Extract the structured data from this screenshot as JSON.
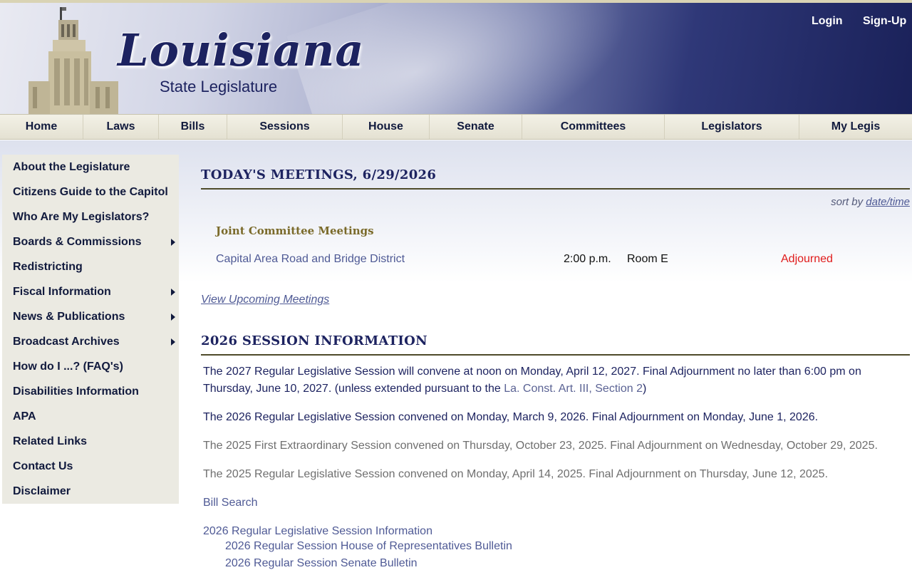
{
  "header": {
    "logo_title": "Louisiana",
    "logo_subtitle": "State Legislature",
    "login_label": "Login",
    "signup_label": "Sign-Up"
  },
  "nav": {
    "items": [
      "Home",
      "Laws",
      "Bills",
      "Sessions",
      "House",
      "Senate",
      "Committees",
      "Legislators",
      "My Legis"
    ]
  },
  "sidebar": {
    "items": [
      {
        "label": "About the Legislature",
        "has_submenu": false
      },
      {
        "label": "Citizens Guide to the Capitol",
        "has_submenu": false
      },
      {
        "label": "Who Are My Legislators?",
        "has_submenu": false
      },
      {
        "label": "Boards & Commissions",
        "has_submenu": true
      },
      {
        "label": "Redistricting",
        "has_submenu": false
      },
      {
        "label": "Fiscal Information",
        "has_submenu": true
      },
      {
        "label": "News & Publications",
        "has_submenu": true
      },
      {
        "label": "Broadcast Archives",
        "has_submenu": true
      },
      {
        "label": "How do I ...? (FAQ's)",
        "has_submenu": false
      },
      {
        "label": "Disabilities Information",
        "has_submenu": false
      },
      {
        "label": "APA",
        "has_submenu": false
      },
      {
        "label": "Related Links",
        "has_submenu": false
      },
      {
        "label": "Contact Us",
        "has_submenu": false
      },
      {
        "label": "Disclaimer",
        "has_submenu": false
      }
    ]
  },
  "meetings": {
    "heading": "TODAY'S MEETINGS, 6/29/2026",
    "sort_prefix": "sort by",
    "sort_link": "date/time",
    "group_heading": "Joint Committee Meetings",
    "rows": [
      {
        "name": "Capital Area Road and Bridge District",
        "time": "2:00 p.m.",
        "room": "Room E",
        "status": "Adjourned"
      }
    ],
    "upcoming_link": "View Upcoming Meetings"
  },
  "session": {
    "heading": "2026 SESSION INFORMATION",
    "p1_a": "The 2027 Regular Legislative Session will convene at noon on Monday, April 12, 2027.   Final Adjournment no later than 6:00 pm on Thursday, June 10, 2027.   (unless extended pursuant to the ",
    "p1_link": "La. Const. Art. III, Section 2",
    "p1_b": ")",
    "p2": "The 2026 Regular Legislative Session convened on Monday, March 9, 2026.   Final Adjournment on Monday, June 1, 2026.",
    "p3": "The 2025 First Extraordinary Session convened on Thursday, October 23, 2025.   Final Adjournment on Wednesday, October 29, 2025.",
    "p4": "The 2025 Regular Legislative Session convened on Monday, April 14, 2025.   Final Adjournment on Thursday, June 12, 2025.",
    "bill_search": "Bill Search",
    "info_link": "2026 Regular Legislative Session Information",
    "house_bulletin": "2026 Regular Session House of Representatives Bulletin",
    "senate_bulletin": "2026 Regular Session Senate Bulletin"
  },
  "colors": {
    "navy": "#1d2360",
    "link": "#4f5a95",
    "status_red": "#e01b1b",
    "gold_rule": "#4e4b2a"
  }
}
